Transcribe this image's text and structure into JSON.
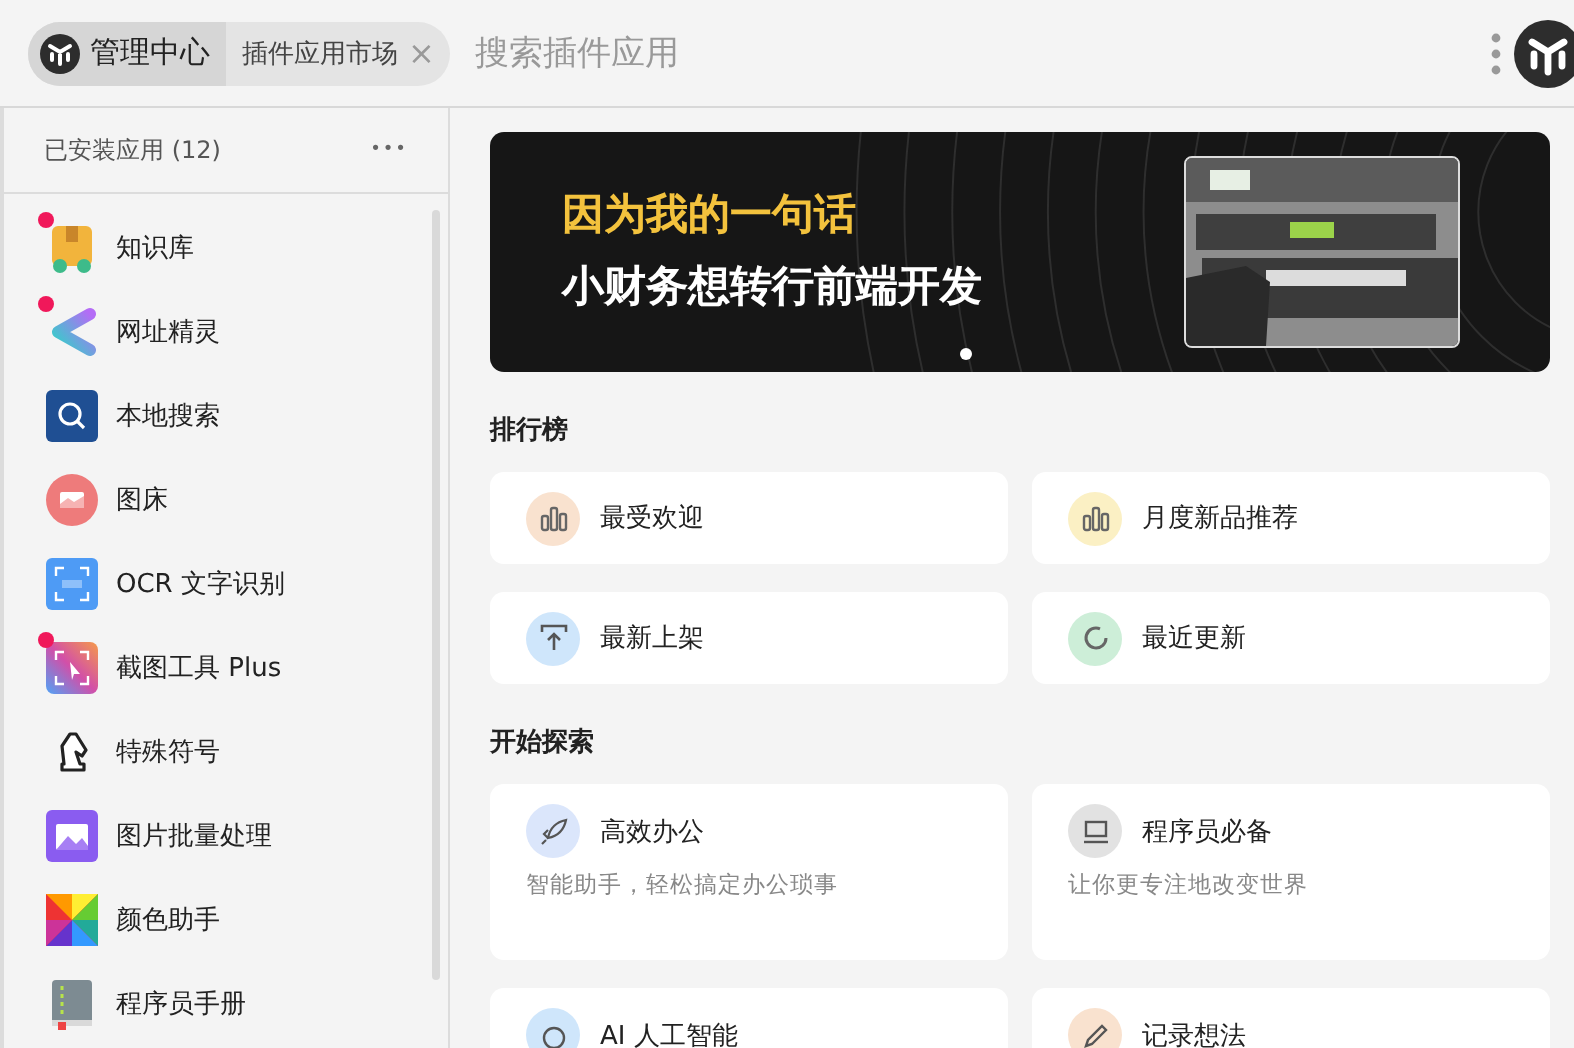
{
  "tabs": [
    {
      "label": "管理中心",
      "selected": true
    },
    {
      "label": "插件应用市场",
      "selected": false,
      "close": "×"
    }
  ],
  "search": {
    "placeholder": "搜索插件应用"
  },
  "sidebar": {
    "title": "已安装应用 (12)",
    "more": "•••",
    "items": [
      {
        "label": "知识库",
        "badge": true
      },
      {
        "label": "网址精灵",
        "badge": true
      },
      {
        "label": "本地搜索",
        "badge": false
      },
      {
        "label": "图床",
        "badge": false
      },
      {
        "label": "OCR 文字识别",
        "badge": false
      },
      {
        "label": "截图工具 Plus",
        "badge": true
      },
      {
        "label": "特殊符号",
        "badge": false
      },
      {
        "label": "图片批量处理",
        "badge": false
      },
      {
        "label": "颜色助手",
        "badge": false
      },
      {
        "label": "程序员手册",
        "badge": false
      }
    ]
  },
  "banner": {
    "headline": "因为我的一句话",
    "subline": "小财务想转行前端开发",
    "dots": [
      {
        "selected": true
      }
    ]
  },
  "ranking": {
    "title": "排行榜",
    "cards": [
      {
        "label": "最受欢迎"
      },
      {
        "label": "月度新品推荐"
      },
      {
        "label": "最新上架"
      },
      {
        "label": "最近更新"
      }
    ]
  },
  "explore": {
    "title": "开始探索",
    "cards": [
      {
        "label": "高效办公",
        "description": "智能助手，轻松搞定办公琐事"
      },
      {
        "label": "程序员必备",
        "description": "让你更专注地改变世界"
      },
      {
        "label": "AI 人工智能"
      },
      {
        "label": "记录想法"
      }
    ]
  }
}
